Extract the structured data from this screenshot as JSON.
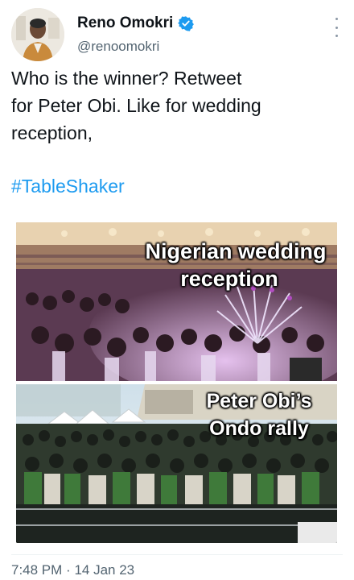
{
  "author": {
    "display_name": "Reno Omokri",
    "handle": "@renoomokri",
    "verified": true
  },
  "tweet": {
    "text_lines": [
      "Who is the winner? Retweet",
      "for Peter Obi. Like for wedding",
      "reception,"
    ],
    "hashtag": "#TableShaker"
  },
  "media": {
    "top_caption_line1": "Nigerian wedding",
    "top_caption_line2": "reception",
    "bottom_caption_line1": "Peter Obi’s",
    "bottom_caption_line2": "Ondo rally"
  },
  "footer": {
    "time": "7:48 PM",
    "separator": "·",
    "date": "14 Jan 23"
  },
  "colors": {
    "link": "#1d9bf0",
    "verified": "#1d9bf0",
    "secondary_text": "#536471"
  },
  "icons": {
    "verified": "verified-badge-icon",
    "more": "more-vertical-icon"
  }
}
